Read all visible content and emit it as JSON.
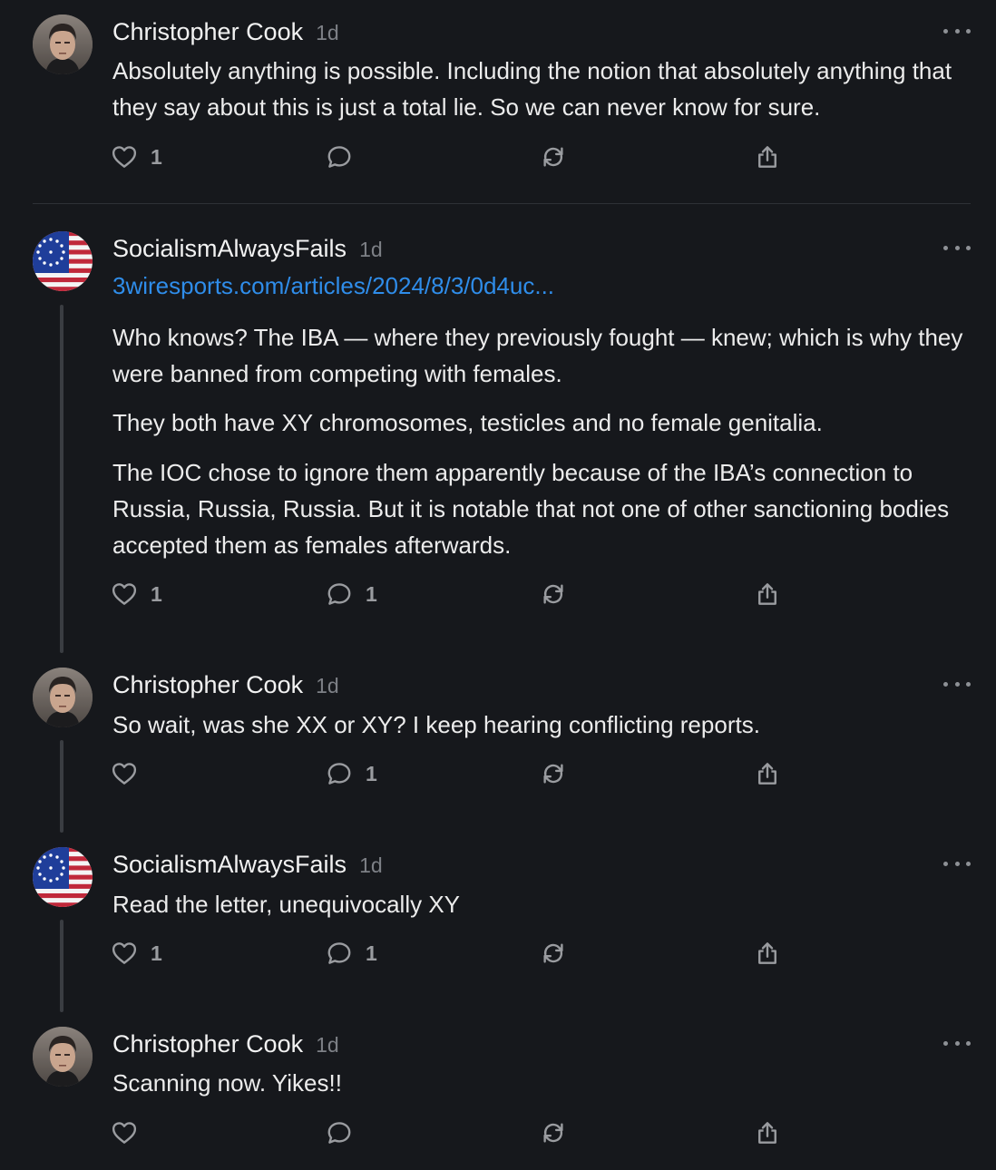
{
  "posts": [
    {
      "author": "Christopher Cook",
      "time": "1d",
      "avatar_icon": "portrait-man-icon",
      "paragraphs": [
        "Absolutely anything is possible. Including the notion that absolutely anything that they say about this is just a total lie. So we can never know for sure."
      ],
      "likes": "1",
      "replies": ""
    },
    {
      "author": "SocialismAlwaysFails",
      "time": "1d",
      "avatar_icon": "betsy-ross-flag-icon",
      "link": "3wiresports.com/articles/2024/8/3/0d4uc...",
      "paragraphs": [
        "Who knows? The IBA — where they previously fought — knew; which is why they were banned from competing with females.",
        "They both have XY chromosomes, testicles and no female genitalia.",
        "The IOC chose to ignore them apparently because of the IBA’s connection to Russia, Russia, Russia. But it is notable that not one of other sanctioning bodies accepted them as females afterwards."
      ],
      "likes": "1",
      "replies": "1"
    },
    {
      "author": "Christopher Cook",
      "time": "1d",
      "avatar_icon": "portrait-man-icon",
      "paragraphs": [
        "So wait, was she XX or XY? I keep hearing conflicting reports."
      ],
      "likes": "",
      "replies": "1"
    },
    {
      "author": "SocialismAlwaysFails",
      "time": "1d",
      "avatar_icon": "betsy-ross-flag-icon",
      "paragraphs": [
        "Read the letter, unequivocally XY"
      ],
      "likes": "1",
      "replies": "1"
    },
    {
      "author": "Christopher Cook",
      "time": "1d",
      "avatar_icon": "portrait-man-icon",
      "paragraphs": [
        "Scanning now. Yikes!!"
      ],
      "likes": "",
      "replies": ""
    }
  ],
  "colors": {
    "background": "#16181c",
    "link": "#2f8dea",
    "muted": "#9a9ca0"
  }
}
